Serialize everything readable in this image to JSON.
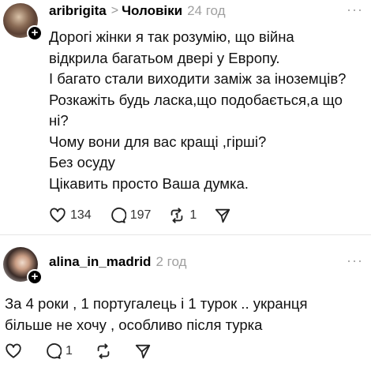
{
  "posts": [
    {
      "username": "aribrigita",
      "topic_chevron": ">",
      "topic": "Чоловіки",
      "time": "24 год",
      "more": "···",
      "lines": [
        "Дорогі жінки я так розумію, що війна",
        "відкрила багатьом двері у Европу.",
        "І багато стали виходити заміж за іноземців?",
        "Розкажіть будь ласка,що подобається,а що",
        "ні?",
        "Чому вони для вас кращі ,гірші?",
        "Без осуду",
        "Цікавить просто Ваша думка."
      ],
      "likes": "134",
      "comments": "197",
      "reposts": "1"
    },
    {
      "username": "alina_in_madrid",
      "time": "2 год",
      "more": "···",
      "lines": [
        "За 4 роки , 1 португалець і 1 турок .. укранця",
        "більше не хочу , особливо  після турка"
      ],
      "likes": "",
      "comments": "1",
      "reposts": ""
    }
  ],
  "icons": {
    "plus": "+",
    "like": "heart-icon",
    "comment": "comment-bubble-icon",
    "repost": "repost-icon",
    "share": "send-icon"
  }
}
